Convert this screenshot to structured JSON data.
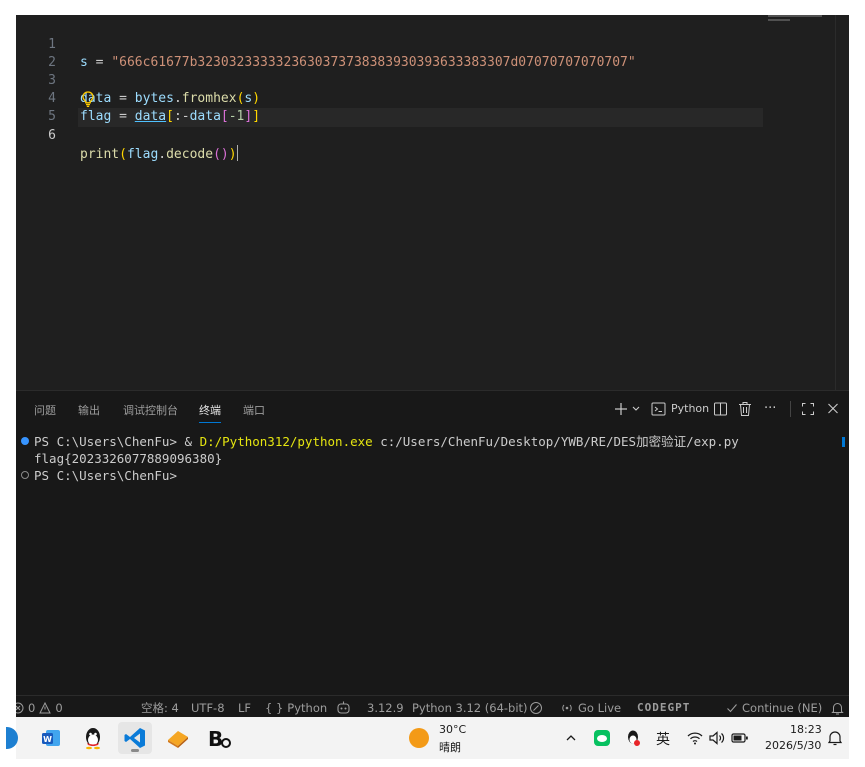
{
  "editor": {
    "lines": [
      {
        "n": "1"
      },
      {
        "n": "2"
      },
      {
        "n": "3"
      },
      {
        "n": "4"
      },
      {
        "n": "5"
      },
      {
        "n": "6"
      }
    ],
    "line1": {
      "var": "s",
      "op": " = ",
      "str": "\"666c61677b3230323333323630373738383930393633383307d07070707070707\""
    },
    "line3": {
      "var": "data",
      "op": " = ",
      "obj": "bytes",
      "dot": ".",
      "fn": "fromhex",
      "p_open": "(",
      "arg": "s",
      "p_close": ")"
    },
    "line4": {
      "var": "flag",
      "op": " = ",
      "data": "data",
      "b_open": "[",
      "colon": ":-",
      "data2": "data",
      "b2_open": "[",
      "num": "-1",
      "b2_close": "]",
      "b_close": "]"
    },
    "line6": {
      "fn": "print",
      "p_open": "(",
      "var": "flag",
      "dot": ".",
      "method": "decode",
      "p2": "()",
      "p_close": ")"
    }
  },
  "panel": {
    "tabs": [
      "问题",
      "输出",
      "调试控制台",
      "终端",
      "端口"
    ],
    "active_tab": "终端",
    "shell_label": "Python",
    "more_label": "···"
  },
  "terminal": {
    "line1": {
      "prompt": "PS C:\\Users\\ChenFu> ",
      "amp": "& ",
      "exe": "D:/Python312/python.exe",
      "script": " c:/Users/ChenFu/Desktop/YWB/RE/DES加密验证/exp.py"
    },
    "line2": "flag{2023326077889096380}",
    "line3": "PS C:\\Users\\ChenFu>"
  },
  "statusbar": {
    "errors": "0",
    "warnings": "0",
    "spaces": "空格: 4",
    "encoding": "UTF-8",
    "eol": "LF",
    "braces": "{ }",
    "language": "Python",
    "version": "3.12.9",
    "interpreter": "Python 3.12 (64-bit)",
    "go_live": "Go Live",
    "codegpt": "CODEGPT",
    "continue": "Continue (NE)"
  },
  "taskbar": {
    "weather_temp": "30°C",
    "weather_desc": "晴朗",
    "ime": "英",
    "time": "18:23",
    "date": "2026/5/30"
  },
  "colors": {
    "accent": "#0078d4",
    "editor_bg": "#1f1f1f",
    "panel_bg": "#181818",
    "taskbar_bg": "#f3f3f3"
  }
}
